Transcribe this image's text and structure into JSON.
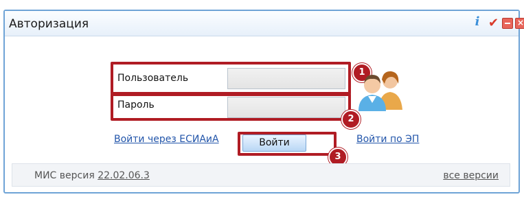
{
  "window": {
    "title": "Авторизация"
  },
  "form": {
    "user_label": "Пользователь",
    "user_value": "",
    "password_label": "Пароль",
    "password_value": ""
  },
  "links": {
    "esia": "Войти через ЕСИАиА",
    "ep": "Войти по ЭП"
  },
  "login_button": "Войти",
  "badges": [
    "1",
    "2",
    "3"
  ],
  "footer": {
    "version_prefix": "МИС версия ",
    "version": "22.02.06.3",
    "all_versions": "все версии"
  },
  "colors": {
    "highlight": "#b01c24",
    "border": "#6ea3d6",
    "link": "#2255aa"
  },
  "icons": [
    "info-icon",
    "check-icon",
    "minimize-icon",
    "close-icon",
    "users-avatar-icon"
  ]
}
